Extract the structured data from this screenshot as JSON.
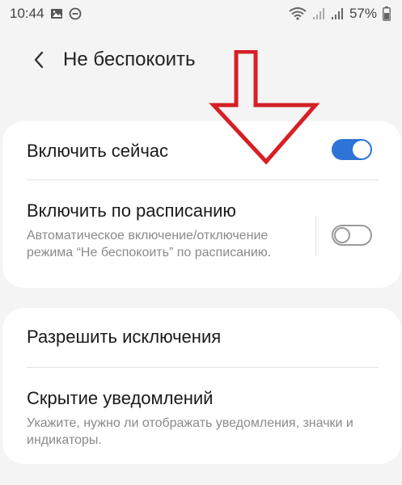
{
  "status_bar": {
    "time": "10:44",
    "battery": "57%",
    "icons": [
      "image-icon",
      "dnd-icon",
      "wifi-icon",
      "signal-1-icon",
      "signal-2-icon",
      "battery-icon"
    ]
  },
  "app_bar": {
    "title": "Не беспокоить",
    "back_icon": "back-chevron-icon"
  },
  "card1": {
    "enable_now": {
      "label": "Включить сейчас",
      "enabled": true
    },
    "schedule": {
      "label": "Включить по расписанию",
      "description": "Автоматическое включение/отключение режима “Не беспокоить” по расписанию.",
      "enabled": false
    }
  },
  "card2": {
    "exceptions": {
      "label": "Разрешить исключения"
    },
    "hide_notifications": {
      "label": "Скрытие уведомлений",
      "description": "Укажите, нужно ли отображать уведомления, значки и индикаторы."
    }
  },
  "colors": {
    "accent": "#2e74d6",
    "annotation": "#d61f26",
    "background": "#f4f4f4",
    "card": "#ffffff"
  }
}
